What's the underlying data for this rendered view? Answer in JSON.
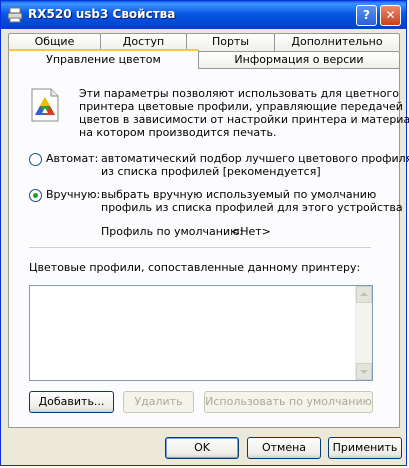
{
  "window": {
    "title": "RX520 usb3 Свойства"
  },
  "title_buttons": {
    "help": "?",
    "close": "✕"
  },
  "tabs_row1": [
    "Общие",
    "Доступ",
    "Порты",
    "Дополнительно"
  ],
  "tabs_row2": [
    "Управление цветом",
    "Информация о версии"
  ],
  "description": {
    "lines": [
      "Эти параметры позволяют использовать для цветного",
      "принтера цветовые профили, управляющие передачей",
      "цветов в зависимости от настройки принтера и материала,",
      "на котором производится печать."
    ]
  },
  "auto_option": {
    "label": "Автомат:",
    "selected": false,
    "lines": [
      "автоматический подбор лучшего цветового профиля",
      "из списка  профилей [рекомендуется]"
    ]
  },
  "manual_option": {
    "label": "Вручную:",
    "selected": true,
    "lines": [
      "выбрать вручную используемый по умолчанию",
      "профиль из списка профилей для этого устройства"
    ]
  },
  "default_profile": {
    "label": "Профиль по умолчанию:",
    "value": "<Нет>"
  },
  "profiles_list": {
    "label": "Цветовые профили, сопоставленные данному принтеру:",
    "items": []
  },
  "list_buttons": {
    "add": "Добавить...",
    "remove": "Удалить",
    "set_default": "Использовать по умолчанию"
  },
  "dialog_buttons": {
    "ok": "OK",
    "cancel": "Отмена",
    "apply": "Применить"
  }
}
